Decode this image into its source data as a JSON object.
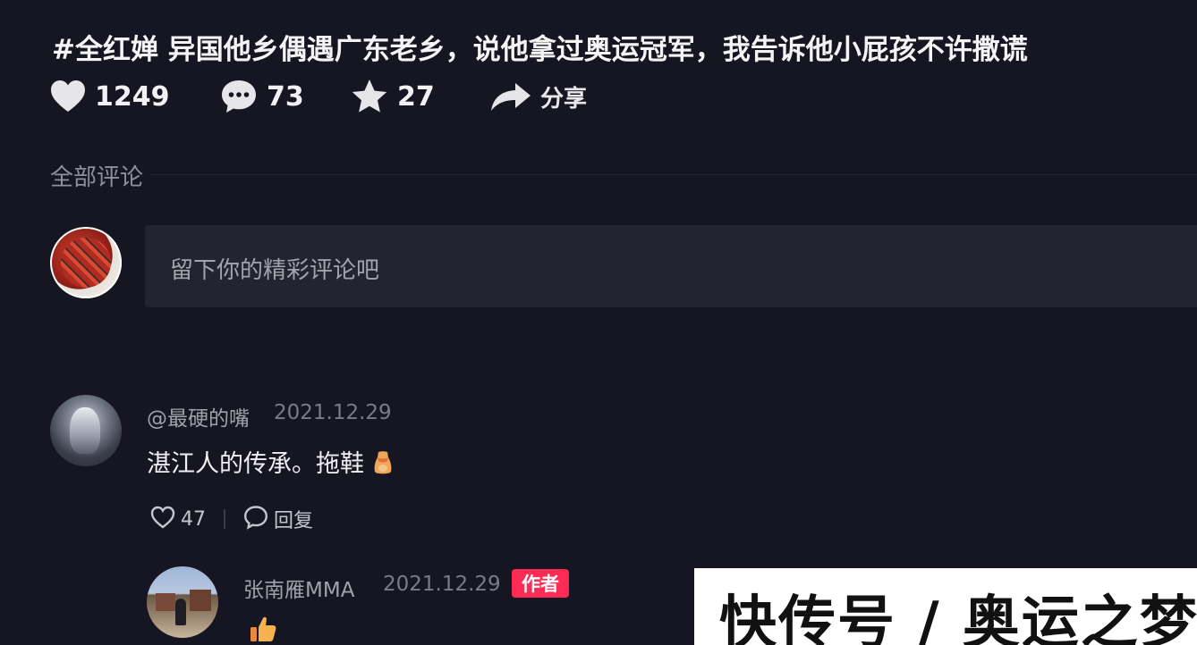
{
  "post": {
    "title": "#全红婵 异国他乡偶遇广东老乡，说他拿过奥运冠军，我告诉他小屁孩不许撒谎"
  },
  "stats": {
    "likes": "1249",
    "comments": "73",
    "favorites": "27",
    "share_label": "分享"
  },
  "comments_section": {
    "label": "全部评论",
    "input_placeholder": "留下你的精彩评论吧"
  },
  "comments": [
    {
      "username": "@最硬的嘴",
      "date": "2021.12.29",
      "text": "湛江人的传承。拖鞋",
      "likes": "47",
      "reply_label": "回复"
    }
  ],
  "reply": {
    "username": "张南雁MMA",
    "date": "2021.12.29",
    "badge": "作者"
  },
  "watermark": {
    "text": "快传号 / 奥运之梦"
  },
  "colors": {
    "background": "#161622",
    "input_background": "#232430",
    "author_badge": "#fe2c55"
  }
}
